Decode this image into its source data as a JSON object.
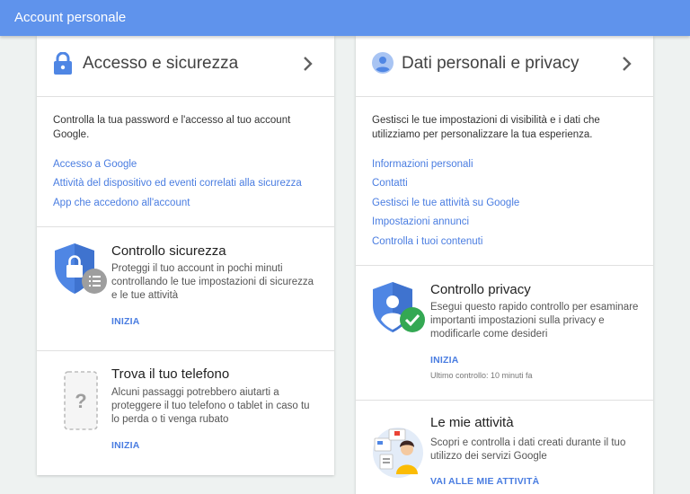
{
  "header": {
    "title": "Account personale"
  },
  "left": {
    "section_title": "Accesso e sicurezza",
    "description": "Controlla la tua password e l'accesso al tuo account Google.",
    "links": [
      "Accesso a Google",
      "Attività del dispositivo ed eventi correlati alla sicurezza",
      "App che accedono all'account"
    ],
    "tiles": [
      {
        "title": "Controllo sicurezza",
        "text": "Proteggi il tuo account in pochi minuti controllando le tue impostazioni di sicurezza e le tue attività",
        "action": "INIZIA"
      },
      {
        "title": "Trova il tuo telefono",
        "text": "Alcuni passaggi potrebbero aiutarti a proteggere il tuo telefono o tablet in caso tu lo perda o ti venga rubato",
        "action": "INIZIA"
      }
    ]
  },
  "right": {
    "section_title": "Dati personali e privacy",
    "description": "Gestisci le tue impostazioni di visibilità e i dati che utilizziamo per personalizzare la tua esperienza.",
    "links": [
      "Informazioni personali",
      "Contatti",
      "Gestisci le tue attività su Google",
      "Impostazioni annunci",
      "Controlla i tuoi contenuti"
    ],
    "tiles": [
      {
        "title": "Controllo privacy",
        "text": "Esegui questo rapido controllo per esaminare importanti impostazioni sulla privacy e modificarle come desideri",
        "action": "INIZIA",
        "meta": "Ultimo controllo: 10 minuti fa"
      },
      {
        "title": "Le mie attività",
        "text": "Scopri e controlla i dati creati durante il tuo utilizzo dei servizi Google",
        "action": "VAI ALLE MIE ATTIVITÀ"
      }
    ]
  },
  "colors": {
    "header": "#5f93ec",
    "link": "#4a7de1",
    "shield": "#4f86e4",
    "check": "#34a853",
    "background": "#eef2f1"
  },
  "icons": {
    "left_header": "lock-icon",
    "right_header": "person-icon",
    "chevron": "chevron-right-icon",
    "security_tile": "shield-lock-icon",
    "phone_tile": "phone-question-icon",
    "privacy_tile": "shield-person-check-icon",
    "activity_tile": "activity-illustration"
  }
}
